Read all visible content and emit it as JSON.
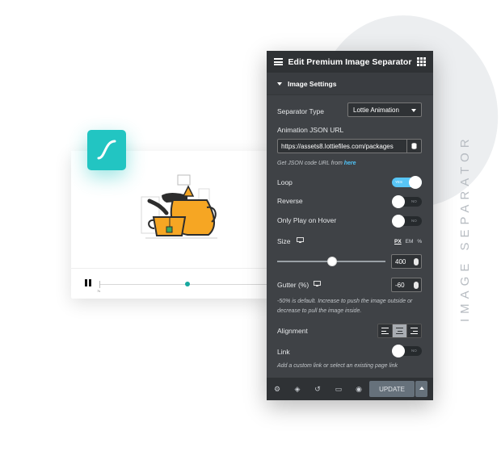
{
  "side_title": "IMAGE SEPARATOR",
  "player": {
    "tick_label": "7k"
  },
  "panel": {
    "title": "Edit Premium Image Separator",
    "section": "Image Settings",
    "separator_type": {
      "label": "Separator Type",
      "value": "Lottie Animation"
    },
    "animation_url": {
      "label": "Animation JSON URL",
      "value": "https://assets8.lottiefiles.com/packages",
      "help_prefix": "Get JSON code URL from ",
      "help_link": "here"
    },
    "loop": {
      "label": "Loop",
      "state": "YES"
    },
    "reverse": {
      "label": "Reverse",
      "state": "NO"
    },
    "hover": {
      "label": "Only Play on Hover",
      "state": "NO"
    },
    "size": {
      "label": "Size",
      "units": [
        "PX",
        "EM",
        "%"
      ],
      "value": "400",
      "slider_fraction": 0.5
    },
    "gutter": {
      "label": "Gutter (%)",
      "value": "-60",
      "help": "-50% is default. Increase to push the image outside or decrease to pull the image inside."
    },
    "alignment": {
      "label": "Alignment",
      "selected": "center"
    },
    "link": {
      "label": "Link",
      "state": "NO",
      "help": "Add a custom link or select an existing page link"
    },
    "footer": {
      "update": "UPDATE",
      "icons": [
        "settings-icon",
        "layers-icon",
        "history-icon",
        "responsive-icon",
        "preview-icon"
      ]
    }
  },
  "colors": {
    "panel": "#3f4246",
    "header": "#2f3235",
    "accent": "#58c6f7",
    "lottie": "#22c5c2",
    "teapot": "#f6a623"
  }
}
